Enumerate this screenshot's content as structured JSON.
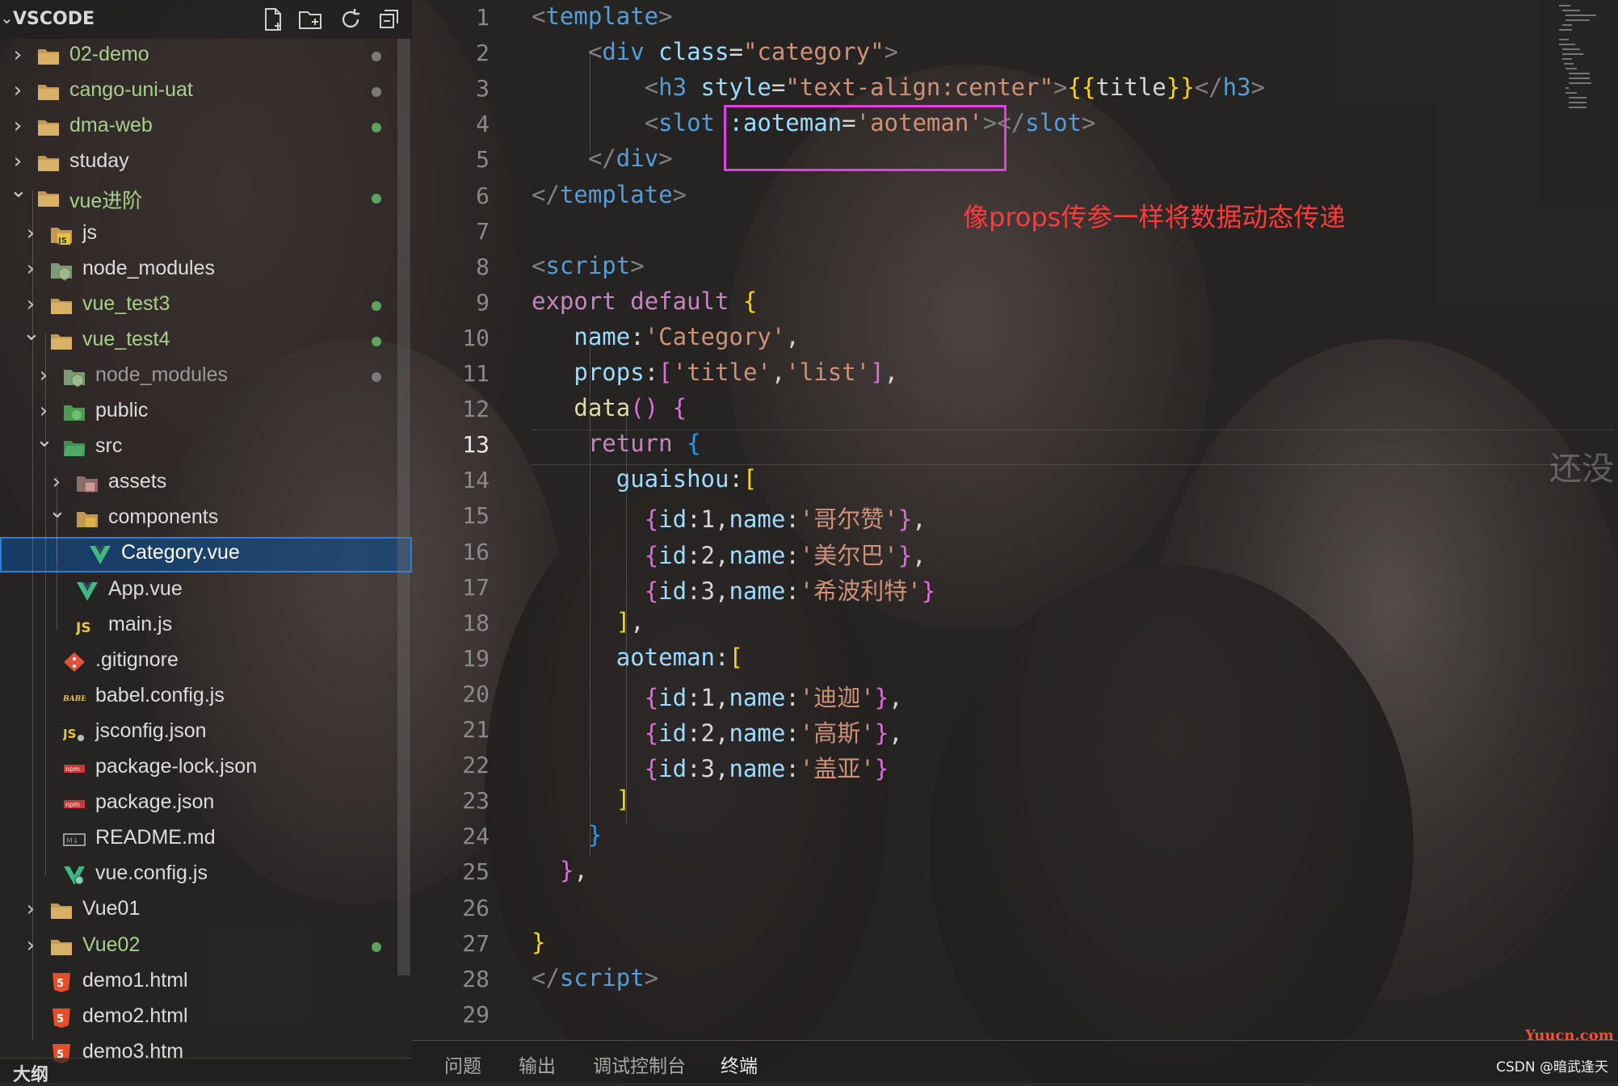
{
  "explorer": {
    "title": "VSCODE",
    "items": [
      {
        "label": "02-demo",
        "kind": "folder",
        "state": "closed",
        "depth": 0,
        "mod": true,
        "dot": "gray"
      },
      {
        "label": "cango-uni-uat",
        "kind": "folder",
        "state": "closed",
        "depth": 0,
        "mod": true,
        "dot": "gray"
      },
      {
        "label": "dma-web",
        "kind": "folder",
        "state": "closed",
        "depth": 0,
        "mod": true,
        "dot": "green"
      },
      {
        "label": "studay",
        "kind": "folder",
        "state": "closed",
        "depth": 0,
        "mod": false,
        "dot": ""
      },
      {
        "label": "vue进阶",
        "kind": "folder",
        "state": "open",
        "depth": 0,
        "mod": true,
        "dot": "green"
      },
      {
        "label": "js",
        "kind": "folder-js",
        "state": "closed",
        "depth": 1,
        "mod": false,
        "dot": ""
      },
      {
        "label": "node_modules",
        "kind": "folder-node",
        "state": "closed",
        "depth": 1,
        "mod": false,
        "dot": ""
      },
      {
        "label": "vue_test3",
        "kind": "folder",
        "state": "closed",
        "depth": 1,
        "mod": true,
        "dot": "green"
      },
      {
        "label": "vue_test4",
        "kind": "folder",
        "state": "open",
        "depth": 1,
        "mod": true,
        "dot": "green"
      },
      {
        "label": "node_modules",
        "kind": "folder-node",
        "state": "closed",
        "depth": 2,
        "mod": false,
        "dim": true,
        "dot": "gray"
      },
      {
        "label": "public",
        "kind": "folder-public",
        "state": "closed",
        "depth": 2,
        "mod": false,
        "dot": ""
      },
      {
        "label": "src",
        "kind": "folder-src",
        "state": "open",
        "depth": 2,
        "mod": false,
        "dot": ""
      },
      {
        "label": "assets",
        "kind": "folder-assets",
        "state": "closed",
        "depth": 3,
        "mod": false,
        "dot": ""
      },
      {
        "label": "components",
        "kind": "folder-components",
        "state": "open",
        "depth": 3,
        "mod": false,
        "dot": ""
      },
      {
        "label": "Category.vue",
        "kind": "vue",
        "state": "file",
        "depth": 4,
        "mod": false,
        "dot": "",
        "selected": true
      },
      {
        "label": "App.vue",
        "kind": "vue",
        "state": "file",
        "depth": 3,
        "mod": false,
        "dot": ""
      },
      {
        "label": "main.js",
        "kind": "js",
        "state": "file",
        "depth": 3,
        "mod": false,
        "dot": ""
      },
      {
        "label": ".gitignore",
        "kind": "git",
        "state": "file",
        "depth": 2,
        "mod": false,
        "dot": ""
      },
      {
        "label": "babel.config.js",
        "kind": "babel",
        "state": "file",
        "depth": 2,
        "mod": false,
        "dot": ""
      },
      {
        "label": "jsconfig.json",
        "kind": "jsconfig",
        "state": "file",
        "depth": 2,
        "mod": false,
        "dot": ""
      },
      {
        "label": "package-lock.json",
        "kind": "npm",
        "state": "file",
        "depth": 2,
        "mod": false,
        "dot": ""
      },
      {
        "label": "package.json",
        "kind": "npm",
        "state": "file",
        "depth": 2,
        "mod": false,
        "dot": ""
      },
      {
        "label": "README.md",
        "kind": "md",
        "state": "file",
        "depth": 2,
        "mod": false,
        "dot": ""
      },
      {
        "label": "vue.config.js",
        "kind": "vueconfig",
        "state": "file",
        "depth": 2,
        "mod": false,
        "dot": ""
      },
      {
        "label": "Vue01",
        "kind": "folder",
        "state": "closed",
        "depth": 1,
        "mod": false,
        "dot": ""
      },
      {
        "label": "Vue02",
        "kind": "folder",
        "state": "closed",
        "depth": 1,
        "mod": true,
        "dot": "green"
      },
      {
        "label": "demo1.html",
        "kind": "html",
        "state": "file",
        "depth": 1,
        "mod": false,
        "dot": ""
      },
      {
        "label": "demo2.html",
        "kind": "html",
        "state": "file",
        "depth": 1,
        "mod": false,
        "dot": ""
      },
      {
        "label": "demo3.htm",
        "kind": "html",
        "state": "file",
        "depth": 1,
        "mod": false,
        "dot": ""
      }
    ],
    "outline_label": "大纲",
    "actions": [
      "new-file-icon",
      "new-folder-icon",
      "refresh-icon",
      "collapse-all-icon"
    ]
  },
  "editor": {
    "current_line": 13,
    "lines": [
      [
        [
          "t-br",
          "<"
        ],
        [
          "t-tag",
          "template"
        ],
        [
          "t-br",
          ">"
        ]
      ],
      [
        [
          "t-w",
          "    "
        ],
        [
          "t-br",
          "<"
        ],
        [
          "t-tag",
          "div"
        ],
        [
          "t-w",
          " "
        ],
        [
          "t-attr",
          "class"
        ],
        [
          "t-w",
          "="
        ],
        [
          "t-str",
          "\"category\""
        ],
        [
          "t-br",
          ">"
        ]
      ],
      [
        [
          "t-w",
          "        "
        ],
        [
          "t-br",
          "<"
        ],
        [
          "t-tag",
          "h3"
        ],
        [
          "t-w",
          " "
        ],
        [
          "t-attr",
          "style"
        ],
        [
          "t-w",
          "="
        ],
        [
          "t-str",
          "\"text-align:center\""
        ],
        [
          "t-br",
          ">"
        ],
        [
          "t-y",
          "{{"
        ],
        [
          "t-w",
          "title"
        ],
        [
          "t-y",
          "}}"
        ],
        [
          "t-br",
          "</"
        ],
        [
          "t-tag",
          "h3"
        ],
        [
          "t-br",
          ">"
        ]
      ],
      [
        [
          "t-w",
          "        "
        ],
        [
          "t-br",
          "<"
        ],
        [
          "t-tag",
          "slot"
        ],
        [
          "t-w",
          " "
        ],
        [
          "t-attr",
          ":aoteman"
        ],
        [
          "t-w",
          "="
        ],
        [
          "t-str",
          "'aoteman'"
        ],
        [
          "t-br",
          "></"
        ],
        [
          "t-tag",
          "slot"
        ],
        [
          "t-br",
          ">"
        ]
      ],
      [
        [
          "t-w",
          "    "
        ],
        [
          "t-br",
          "</"
        ],
        [
          "t-tag",
          "div"
        ],
        [
          "t-br",
          ">"
        ]
      ],
      [
        [
          "t-br",
          "</"
        ],
        [
          "t-tag",
          "template"
        ],
        [
          "t-br",
          ">"
        ]
      ],
      [],
      [
        [
          "t-br",
          "<"
        ],
        [
          "t-tag",
          "script"
        ],
        [
          "t-br",
          ">"
        ]
      ],
      [
        [
          "t-kw",
          "export"
        ],
        [
          "t-w",
          " "
        ],
        [
          "t-kw",
          "default"
        ],
        [
          "t-w",
          " "
        ],
        [
          "t-y",
          "{"
        ]
      ],
      [
        [
          "t-w",
          "   "
        ],
        [
          "t-prop",
          "name"
        ],
        [
          "t-w",
          ":"
        ],
        [
          "t-str",
          "'Category'"
        ],
        [
          "t-w",
          ","
        ]
      ],
      [
        [
          "t-w",
          "   "
        ],
        [
          "t-prop",
          "props"
        ],
        [
          "t-w",
          ":"
        ],
        [
          "t-p",
          "["
        ],
        [
          "t-str",
          "'title'"
        ],
        [
          "t-w",
          ","
        ],
        [
          "t-str",
          "'list'"
        ],
        [
          "t-p",
          "]"
        ],
        [
          "t-w",
          ","
        ]
      ],
      [
        [
          "t-w",
          "   "
        ],
        [
          "t-fn",
          "data"
        ],
        [
          "t-p",
          "()"
        ],
        [
          "t-w",
          " "
        ],
        [
          "t-p",
          "{"
        ]
      ],
      [
        [
          "t-w",
          "    "
        ],
        [
          "t-kw",
          "return"
        ],
        [
          "t-w",
          " "
        ],
        [
          "t-b",
          "{"
        ]
      ],
      [
        [
          "t-w",
          "      "
        ],
        [
          "t-prop",
          "guaishou"
        ],
        [
          "t-w",
          ":"
        ],
        [
          "t-y",
          "["
        ]
      ],
      [
        [
          "t-w",
          "        "
        ],
        [
          "t-p",
          "{"
        ],
        [
          "t-prop",
          "id"
        ],
        [
          "t-w",
          ":1,"
        ],
        [
          "t-prop",
          "name"
        ],
        [
          "t-w",
          ":"
        ],
        [
          "t-str",
          "'哥尔赞'"
        ],
        [
          "t-p",
          "}"
        ],
        [
          "t-w",
          ","
        ]
      ],
      [
        [
          "t-w",
          "        "
        ],
        [
          "t-p",
          "{"
        ],
        [
          "t-prop",
          "id"
        ],
        [
          "t-w",
          ":2,"
        ],
        [
          "t-prop",
          "name"
        ],
        [
          "t-w",
          ":"
        ],
        [
          "t-str",
          "'美尔巴'"
        ],
        [
          "t-p",
          "}"
        ],
        [
          "t-w",
          ","
        ]
      ],
      [
        [
          "t-w",
          "        "
        ],
        [
          "t-p",
          "{"
        ],
        [
          "t-prop",
          "id"
        ],
        [
          "t-w",
          ":3,"
        ],
        [
          "t-prop",
          "name"
        ],
        [
          "t-w",
          ":"
        ],
        [
          "t-str",
          "'希波利特'"
        ],
        [
          "t-p",
          "}"
        ]
      ],
      [
        [
          "t-w",
          "      "
        ],
        [
          "t-y",
          "]"
        ],
        [
          "t-w",
          ","
        ]
      ],
      [
        [
          "t-w",
          "      "
        ],
        [
          "t-prop",
          "aoteman"
        ],
        [
          "t-w",
          ":"
        ],
        [
          "t-y",
          "["
        ]
      ],
      [
        [
          "t-w",
          "        "
        ],
        [
          "t-p",
          "{"
        ],
        [
          "t-prop",
          "id"
        ],
        [
          "t-w",
          ":1,"
        ],
        [
          "t-prop",
          "name"
        ],
        [
          "t-w",
          ":"
        ],
        [
          "t-str",
          "'迪迦'"
        ],
        [
          "t-p",
          "}"
        ],
        [
          "t-w",
          ","
        ]
      ],
      [
        [
          "t-w",
          "        "
        ],
        [
          "t-p",
          "{"
        ],
        [
          "t-prop",
          "id"
        ],
        [
          "t-w",
          ":2,"
        ],
        [
          "t-prop",
          "name"
        ],
        [
          "t-w",
          ":"
        ],
        [
          "t-str",
          "'高斯'"
        ],
        [
          "t-p",
          "}"
        ],
        [
          "t-w",
          ","
        ]
      ],
      [
        [
          "t-w",
          "        "
        ],
        [
          "t-p",
          "{"
        ],
        [
          "t-prop",
          "id"
        ],
        [
          "t-w",
          ":3,"
        ],
        [
          "t-prop",
          "name"
        ],
        [
          "t-w",
          ":"
        ],
        [
          "t-str",
          "'盖亚'"
        ],
        [
          "t-p",
          "}"
        ]
      ],
      [
        [
          "t-w",
          "      "
        ],
        [
          "t-y",
          "]"
        ]
      ],
      [
        [
          "t-w",
          "    "
        ],
        [
          "t-b",
          "}"
        ]
      ],
      [
        [
          "t-w",
          "  "
        ],
        [
          "t-p",
          "}"
        ],
        [
          "t-w",
          ","
        ]
      ],
      [],
      [
        [
          "t-y",
          "}"
        ]
      ],
      [
        [
          "t-br",
          "</"
        ],
        [
          "t-tag",
          "script"
        ],
        [
          "t-br",
          ">"
        ]
      ],
      []
    ],
    "annotation": "像props传参一样将数据动态传递",
    "ghost_text": "还没"
  },
  "panel": {
    "tabs": [
      "问题",
      "输出",
      "调试控制台",
      "终端"
    ],
    "active_tab": "终端"
  },
  "watermark": "CSDN @暗武逢天",
  "site_mark": "Yuucn.com",
  "colors": {
    "selection": "#104c8c",
    "highlight_box": "#e23fe6",
    "annotation": "#ff3a3a"
  }
}
